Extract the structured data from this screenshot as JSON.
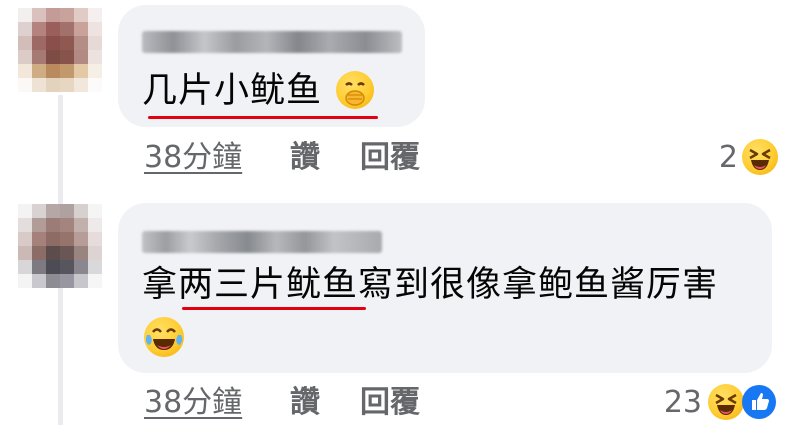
{
  "comments": [
    {
      "author": "",
      "text": "几片小鱿鱼",
      "time_label": "38分鐘",
      "like_label": "讚",
      "reply_label": "回覆",
      "reaction_count": "2",
      "reactions": [
        "laughing-face-icon"
      ]
    },
    {
      "author": "",
      "text_underlined": "拿两三片鱿鱼",
      "text_rest": "寫到很像拿鲍鱼酱厉害",
      "time_label": "38分鐘",
      "like_label": "讚",
      "reply_label": "回覆",
      "reaction_count": "23",
      "reactions": [
        "laughing-face-icon",
        "like-icon"
      ]
    }
  ],
  "colors": {
    "bubble": "#f0f2f5",
    "secondary_text": "#65676b",
    "annotation_red": "#e3000f",
    "like_blue": "#1877f2"
  }
}
